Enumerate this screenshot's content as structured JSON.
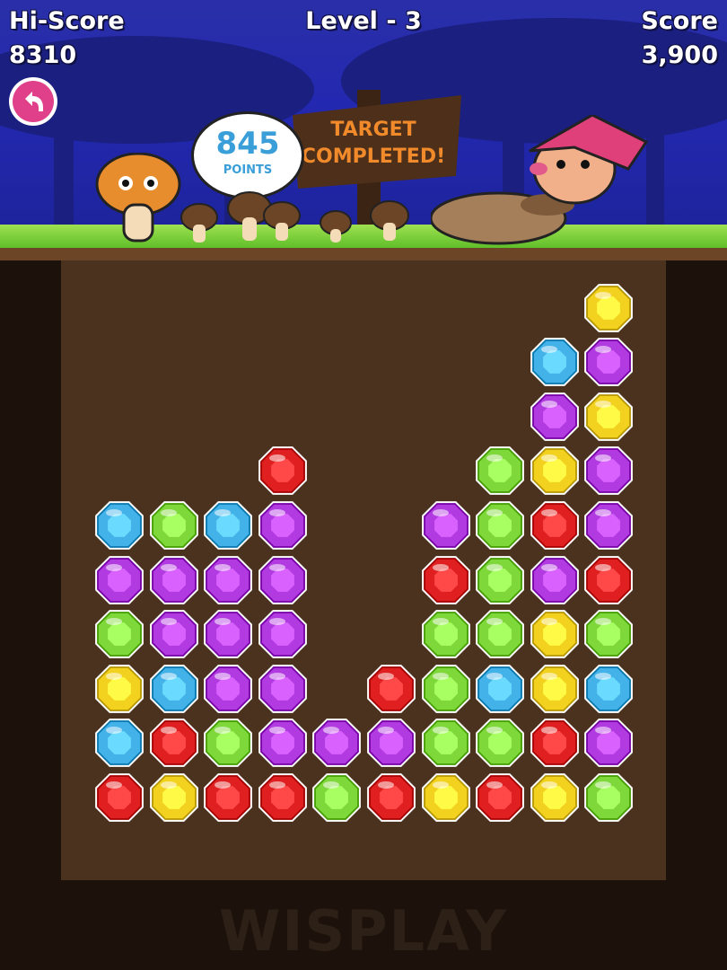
{
  "hud": {
    "hiscore_label": "Hi-Score",
    "hiscore_value": "8310",
    "level_title": "Level - 3",
    "score_label": "Score",
    "score_value": "3,900"
  },
  "buttons": {
    "back_icon": "back-arrow-icon"
  },
  "banner": {
    "points_value": "845",
    "points_label": "POINTS",
    "sign_text": "TARGET\nCOMPLETED!"
  },
  "watermark": "WISPLAY",
  "colors": {
    "red": "#e02020",
    "yellow": "#f2d21e",
    "green": "#7fd83a",
    "blue": "#43b2e8",
    "purple": "#b13ae0"
  },
  "board": {
    "columns": [
      [
        "red",
        "blue",
        "yellow",
        "green",
        "purple",
        "blue"
      ],
      [
        "yellow",
        "red",
        "blue",
        "purple",
        "purple",
        "green"
      ],
      [
        "red",
        "green",
        "purple",
        "purple",
        "purple",
        "blue"
      ],
      [
        "red",
        "purple",
        "purple",
        "purple",
        "purple",
        "purple",
        "red"
      ],
      [
        "green",
        "purple"
      ],
      [
        "red",
        "purple",
        "red"
      ],
      [
        "yellow",
        "green",
        "green",
        "green",
        "red",
        "purple"
      ],
      [
        "red",
        "green",
        "blue",
        "green",
        "green",
        "green",
        "green"
      ],
      [
        "yellow",
        "red",
        "yellow",
        "yellow",
        "purple",
        "red",
        "yellow",
        "purple",
        "blue"
      ],
      [
        "green",
        "purple",
        "blue",
        "green",
        "red",
        "purple",
        "purple",
        "yellow",
        "purple",
        "yellow"
      ]
    ]
  }
}
